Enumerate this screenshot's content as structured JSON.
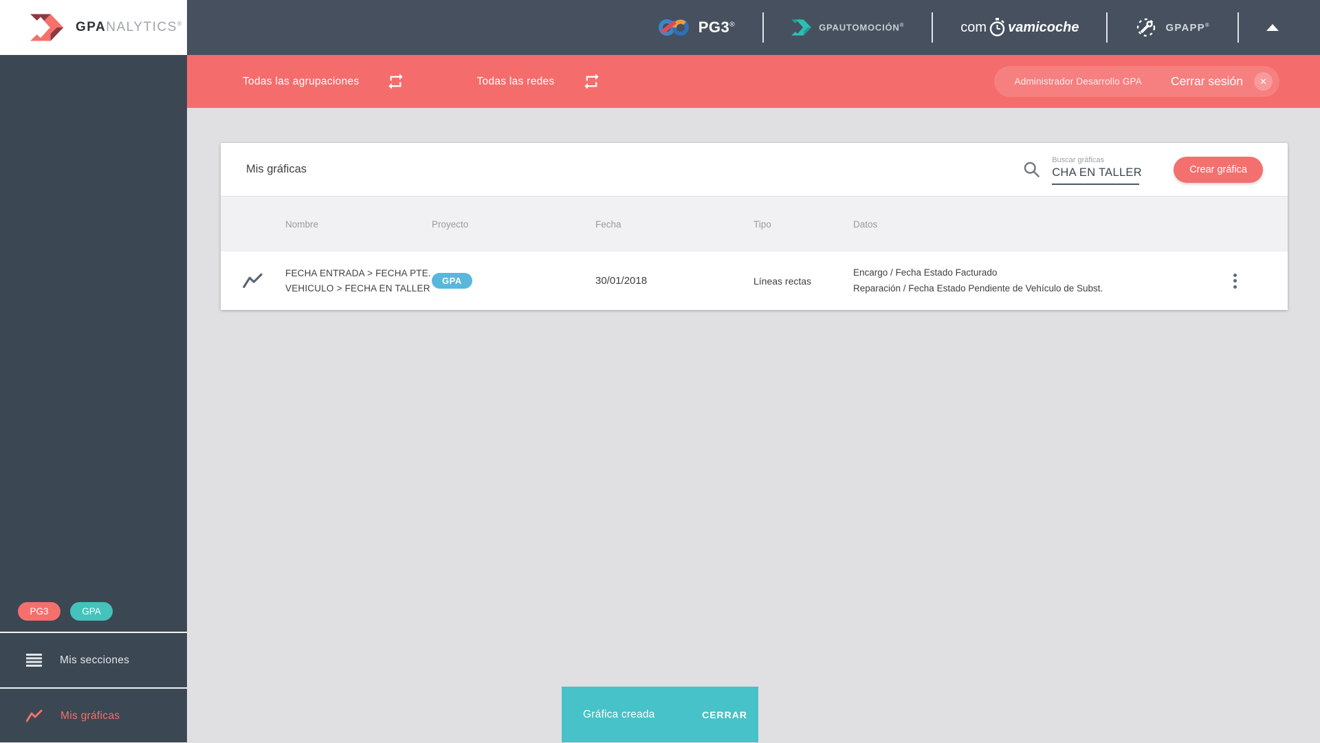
{
  "brand": {
    "bold": "GPA",
    "light": "NALYTICS",
    "reg": "®"
  },
  "topbar": {
    "pg3": "PG3",
    "pg3_reg": "®",
    "gpautomocion": "GPAUTOMOCIÓN",
    "gpautomocion_reg": "®",
    "com": "com",
    "vamicoche": "vamicoche",
    "gpapp": "GPAPP",
    "gpapp_reg": "®"
  },
  "filterbar": {
    "groupings": "Todas las agrupaciones",
    "networks": "Todas las redes",
    "user": "Administrador Desarrollo GPA",
    "logout": "Cerrar sesión"
  },
  "sidebar": {
    "badge_pg3": "PG3",
    "badge_gpa": "GPA",
    "sections_label": "Mis secciones",
    "charts_label": "Mis gráficas"
  },
  "card": {
    "title": "Mis gráficas",
    "search_label": "Buscar gráficas",
    "search_value": "CHA EN TALLER",
    "create_button": "Crear gráfica",
    "columns": [
      "Nombre",
      "Proyecto",
      "Fecha",
      "Tipo",
      "Datos"
    ],
    "row": {
      "name_line1": "FECHA ENTRADA > FECHA PTE.",
      "name_line2": "VEHICULO > FECHA EN TALLER",
      "project_badge": "GPA",
      "date": "30/01/2018",
      "type": "Líneas rectas",
      "data_line1": "Encargo / Fecha Estado Facturado",
      "data_line2": "Reparación / Fecha Estado Pendiente de Vehículo de Subst."
    }
  },
  "snackbar": {
    "message": "Gráfica creada",
    "action": "CERRAR"
  },
  "colors": {
    "accent_red": "#F56C6C",
    "topbar_slate": "#46505E",
    "sidebar_slate": "#3B4753",
    "snackbar_teal": "#47C2C8",
    "badge_blue": "#59B7DC",
    "badge_teal": "#43C3BB"
  },
  "icons": {
    "logo": "gpa-chevron-icon",
    "search": "search-icon",
    "swap": "repeat-icon",
    "row_chart": "line-chart-icon",
    "menu": "hamburger-menu-icon",
    "more": "kebab-menu-icon"
  }
}
